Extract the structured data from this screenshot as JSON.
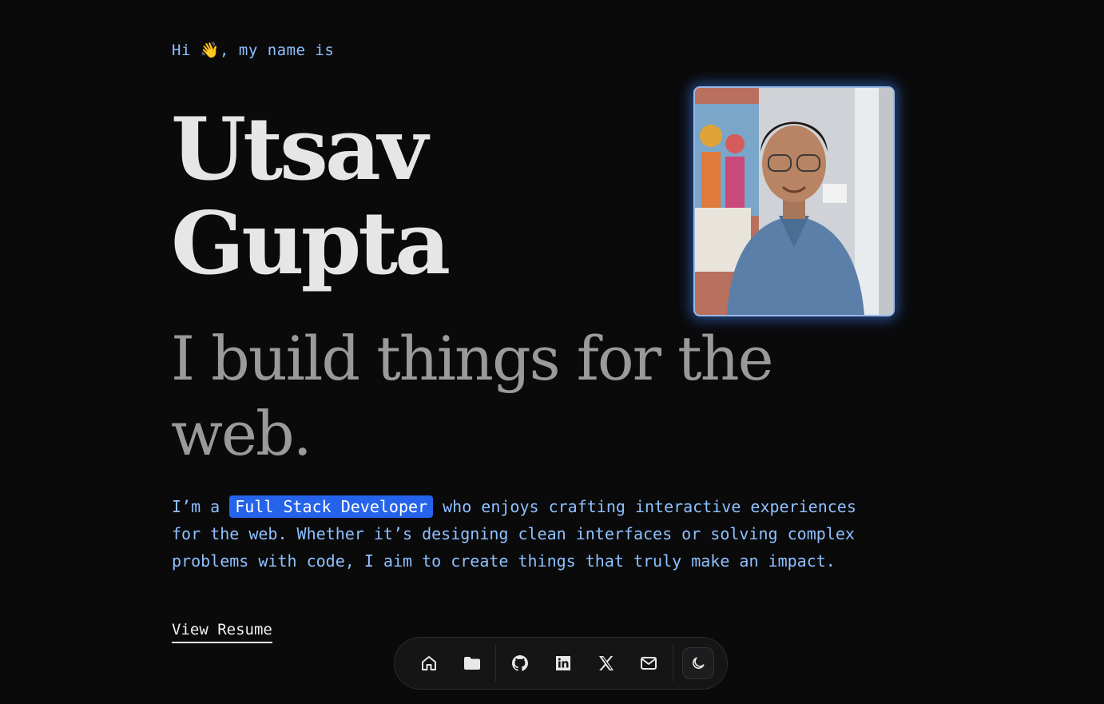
{
  "hero": {
    "greeting_prefix": "Hi ",
    "greeting_emoji": "👋",
    "greeting_suffix": ", my name is",
    "first_name": "Utsav",
    "last_name": "Gupta",
    "tagline": "I build things for the web.",
    "intro_before": "I’m a ",
    "intro_highlight": "Full Stack Developer",
    "intro_after": " who enjoys crafting interactive experiences for the web. Whether it’s designing clean interfaces or solving complex problems with code, I aim to create things that truly make an impact.",
    "resume_label": "View Resume"
  },
  "profile_photo": {
    "glow_color": "#3b82f6"
  },
  "dock": {
    "items": [
      {
        "icon": "home-icon"
      },
      {
        "icon": "folder-icon"
      },
      {
        "icon": "github-icon"
      },
      {
        "icon": "linkedin-icon"
      },
      {
        "icon": "x-twitter-icon"
      },
      {
        "icon": "mail-icon"
      }
    ],
    "theme_toggle_icon": "moon-icon"
  },
  "colors": {
    "background": "#0a0a0b",
    "accent": "#2563eb",
    "mono_text": "#8fc0ff",
    "name_text": "#e6e6e6",
    "tagline_text": "#9a9a9a"
  }
}
